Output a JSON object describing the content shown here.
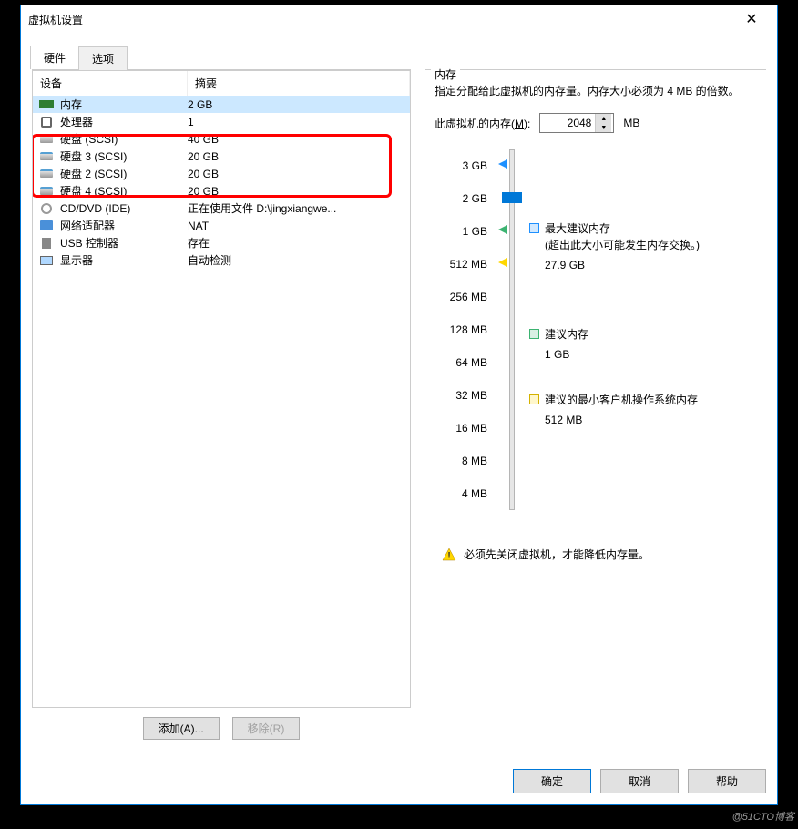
{
  "dialog": {
    "title": "虚拟机设置",
    "tabs": {
      "hardware": "硬件",
      "options": "选项"
    },
    "deviceHeader": {
      "device": "设备",
      "summary": "摘要"
    },
    "devices": [
      {
        "name": "内存",
        "summary": "2 GB",
        "icon": "mem",
        "sel": true
      },
      {
        "name": "处理器",
        "summary": "1",
        "icon": "cpu"
      },
      {
        "name": "硬盘 (SCSI)",
        "summary": "40 GB",
        "icon": "disk"
      },
      {
        "name": "硬盘 3 (SCSI)",
        "summary": "20 GB",
        "icon": "disk"
      },
      {
        "name": "硬盘 2 (SCSI)",
        "summary": "20 GB",
        "icon": "disk"
      },
      {
        "name": "硬盘 4 (SCSI)",
        "summary": "20 GB",
        "icon": "disk"
      },
      {
        "name": "CD/DVD (IDE)",
        "summary": "正在使用文件 D:\\jingxiangwe...",
        "icon": "cd"
      },
      {
        "name": "网络适配器",
        "summary": "NAT",
        "icon": "net"
      },
      {
        "name": "USB 控制器",
        "summary": "存在",
        "icon": "usb"
      },
      {
        "name": "显示器",
        "summary": "自动检测",
        "icon": "mon"
      }
    ],
    "addBtn": "添加(A)...",
    "removeBtn": "移除(R)",
    "memory": {
      "legend": "内存",
      "desc": "指定分配给此虚拟机的内存量。内存大小必须为 4 MB 的倍数。",
      "inputLabelPrefix": "此虚拟机的内存(",
      "inputLabelU": "M",
      "inputLabelSuffix": "):",
      "value": "2048",
      "unit": "MB",
      "ticks": [
        "3 GB",
        "2 GB",
        "1 GB",
        "512 MB",
        "256 MB",
        "128 MB",
        "64 MB",
        "32 MB",
        "16 MB",
        "8 MB",
        "4 MB"
      ],
      "maxRec": {
        "label": "最大建议内存",
        "note": "(超出此大小可能发生内存交换。)",
        "value": "27.9 GB"
      },
      "rec": {
        "label": "建议内存",
        "value": "1 GB"
      },
      "minRec": {
        "label": "建议的最小客户机操作系统内存",
        "value": "512 MB"
      },
      "warning": "必须先关闭虚拟机，才能降低内存量。"
    },
    "ok": "确定",
    "cancel": "取消",
    "help": "帮助"
  },
  "watermark": "@51CTO博客"
}
